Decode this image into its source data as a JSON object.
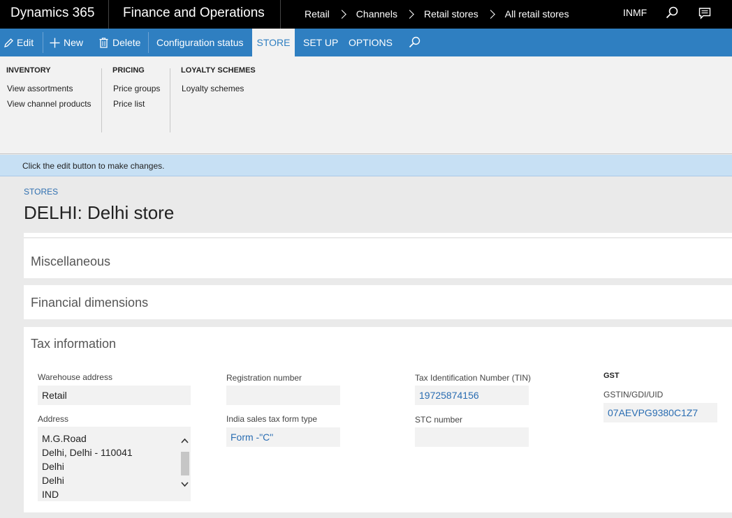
{
  "topbar": {
    "brand": "Dynamics 365",
    "module": "Finance and Operations",
    "breadcrumbs": [
      "Retail",
      "Channels",
      "Retail stores",
      "All retail stores"
    ],
    "company": "INMF"
  },
  "actionbar": {
    "edit": "Edit",
    "new": "New",
    "delete": "Delete",
    "config": "Configuration status",
    "tabs": [
      "STORE",
      "SET UP",
      "OPTIONS"
    ],
    "active_tab": "STORE",
    "accent": "#2f7fc1"
  },
  "ribbon": {
    "groups": [
      {
        "title": "INVENTORY",
        "items": [
          "View assortments",
          "View channel products"
        ]
      },
      {
        "title": "PRICING",
        "items": [
          "Price groups",
          "Price list"
        ]
      },
      {
        "title": "LOYALTY SCHEMES",
        "items": [
          "Loyalty schemes"
        ]
      }
    ]
  },
  "info": {
    "message": "Click the edit button to make changes."
  },
  "page": {
    "breadcrumb": "STORES",
    "title": "DELHI: Delhi store"
  },
  "sections": {
    "misc": "Miscellaneous",
    "financial": "Financial dimensions",
    "tax": "Tax information"
  },
  "tax": {
    "warehouse_label": "Warehouse address",
    "warehouse_value": "Retail",
    "address_label": "Address",
    "address_lines": [
      "M.G.Road",
      "Delhi, Delhi - 110041",
      "Delhi",
      "Delhi",
      "IND"
    ],
    "reg_label": "Registration number",
    "reg_value": "",
    "form_label": "India sales tax form type",
    "form_value": "Form -\"C\"",
    "tin_label": "Tax Identification Number (TIN)",
    "tin_value": "19725874156",
    "stc_label": "STC number",
    "stc_value": "",
    "gst_title": "GST",
    "gstin_label": "GSTIN/GDI/UID",
    "gstin_value": "07AEVPG9380C1Z7"
  }
}
